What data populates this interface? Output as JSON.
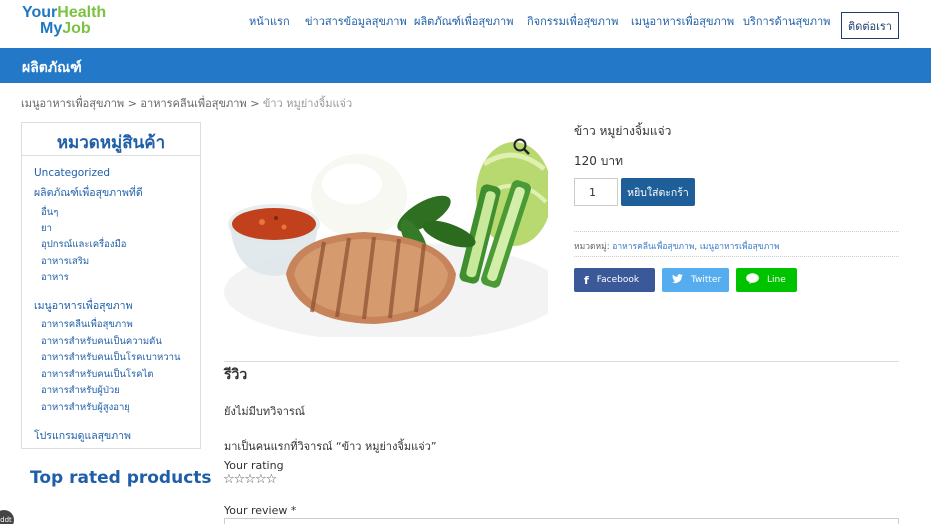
{
  "logo": {
    "line1_a": "Your",
    "line1_b": "Health",
    "line2_a": "My",
    "line2_b": "Job"
  },
  "nav": {
    "items": [
      "หน้าแรก",
      "ข่าวสารข้อมูลสุขภาพ",
      "ผลิตภัณฑ์เพื่อสุขภาพ",
      "กิจกรรมเพื่อสุขภาพ",
      "เมนูอาหารเพื่อสุขภาพ",
      "บริการด้านสุขภาพ"
    ],
    "contact": "ติดต่อเรา"
  },
  "banner": {
    "title": "ผลิตภัณฑ์"
  },
  "breadcrumb": {
    "items": [
      "เมนูอาหารเพื่อสุขภาพ",
      "อาหารคลีนเพื่อสุขภาพ"
    ],
    "separator": ">",
    "current": "ข้าว หมูย่างจิ้มแจ่ว"
  },
  "sidebar": {
    "title": "หมวดหมู่สินค้า",
    "categories": [
      "Uncategorized",
      "ผลิตภัณฑ์เพื่อสุขภาพที่ดี",
      "อื่นๆ",
      "ยา",
      "อุปกรณ์และเครื่องมือ",
      "อาหารเสริม",
      "อาหาร",
      "เมนูอาหารเพื่อสุขภาพ",
      "อาหารคลีนเพื่อสุขภาพ",
      "อาหารสำหรับคนเป็นความดัน",
      "อาหารสำหรับคนเป็นโรคเบาหวาน",
      "อาหารสำหรับคนเป็นโรคไต",
      "อาหารสำหรับผู้ป่วย",
      "อาหารสำหรับผู้สูงอายุ",
      "โปรแกรมดูแลสุขภาพ"
    ],
    "top_rated": "Top rated products"
  },
  "product": {
    "title": "ข้าว หมูย่างจิ้มแจ่ว",
    "price": "120 บาท",
    "quantity": "1",
    "add_to_cart": "หยิบใส่ตะกร้า",
    "category_label": "หมวดหมู่:",
    "categories": [
      "อาหารคลีนเพื่อสุขภาพ",
      "เมนูอาหารเพื่อสุขภาพ"
    ]
  },
  "share": {
    "facebook": "Facebook",
    "twitter": "Twitter",
    "line": "Line"
  },
  "reviews": {
    "heading": "รีวิว",
    "none": "ยังไม่มีบทวิจารณ์",
    "be_first": "มาเป็นคนแรกที่วิจารณ์ “ข้าว หมูย่างจิ้มแจ่ว”",
    "rating_label": "Your rating",
    "stars": "☆☆☆☆☆",
    "review_label": "Your review *"
  },
  "badge": "ddt",
  "colors": {
    "brand_blue": "#2378c8",
    "brand_green": "#7cc242",
    "button_blue": "#1f5f99"
  }
}
